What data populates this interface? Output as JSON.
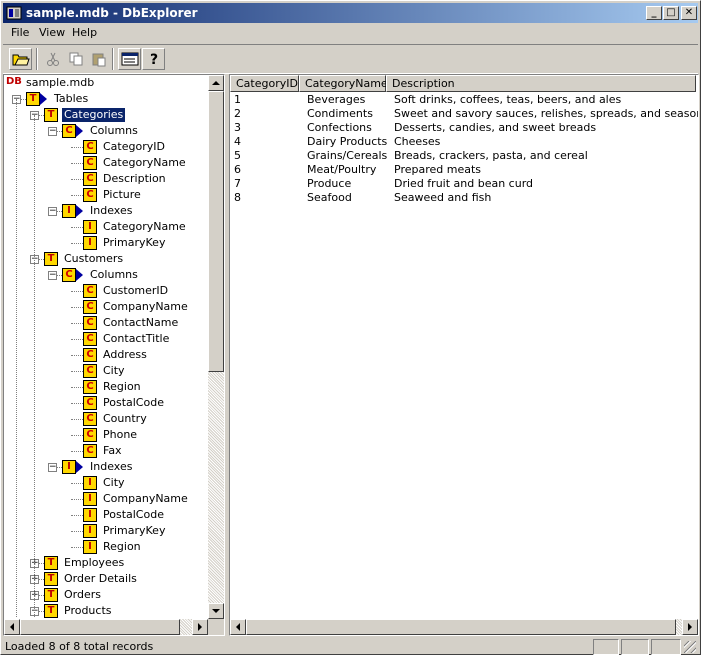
{
  "window": {
    "title": "sample.mdb - DbExplorer",
    "minimize_label": "_",
    "maximize_label": "□",
    "close_label": "✕"
  },
  "menu": [
    "File",
    "View",
    "Help"
  ],
  "toolbar": {
    "icons": [
      "open-folder-icon",
      "cut-icon",
      "copy-icon",
      "paste-icon",
      "properties-icon",
      "help-icon"
    ]
  },
  "tree": {
    "root": "sample.mdb",
    "root_icon_text": "DB",
    "icon_letters": {
      "table": "T",
      "column": "C",
      "index": "I"
    },
    "tables_label": "Tables",
    "selected": "Categories",
    "categories": {
      "label": "Categories",
      "columns_label": "Columns",
      "columns": [
        "CategoryID",
        "CategoryName",
        "Description",
        "Picture"
      ],
      "indexes_label": "Indexes",
      "indexes": [
        "CategoryName",
        "PrimaryKey"
      ]
    },
    "customers": {
      "label": "Customers",
      "columns_label": "Columns",
      "columns": [
        "CustomerID",
        "CompanyName",
        "ContactName",
        "ContactTitle",
        "Address",
        "City",
        "Region",
        "PostalCode",
        "Country",
        "Phone",
        "Fax"
      ],
      "indexes_label": "Indexes",
      "indexes": [
        "City",
        "CompanyName",
        "PostalCode",
        "PrimaryKey",
        "Region"
      ]
    },
    "other_tables": [
      "Employees",
      "Order Details",
      "Orders",
      "Products"
    ]
  },
  "grid": {
    "columns": [
      "CategoryID",
      "CategoryName",
      "Description"
    ],
    "rows": [
      [
        "1",
        "Beverages",
        "Soft drinks, coffees, teas, beers, and ales"
      ],
      [
        "2",
        "Condiments",
        "Sweet and savory sauces, relishes, spreads, and seasonings"
      ],
      [
        "3",
        "Confections",
        "Desserts, candies, and sweet breads"
      ],
      [
        "4",
        "Dairy Products",
        "Cheeses"
      ],
      [
        "5",
        "Grains/Cereals",
        "Breads, crackers, pasta, and cereal"
      ],
      [
        "6",
        "Meat/Poultry",
        "Prepared meats"
      ],
      [
        "7",
        "Produce",
        "Dried fruit and bean curd"
      ],
      [
        "8",
        "Seafood",
        "Seaweed and fish"
      ]
    ]
  },
  "status": {
    "text": "Loaded 8 of 8 total records"
  },
  "colors": {
    "title_gradient_start": "#0a246a",
    "title_gradient_end": "#a6caf0",
    "selection": "#0a246a",
    "icon_fill": "#ffd800",
    "icon_letter": "#c00000"
  }
}
